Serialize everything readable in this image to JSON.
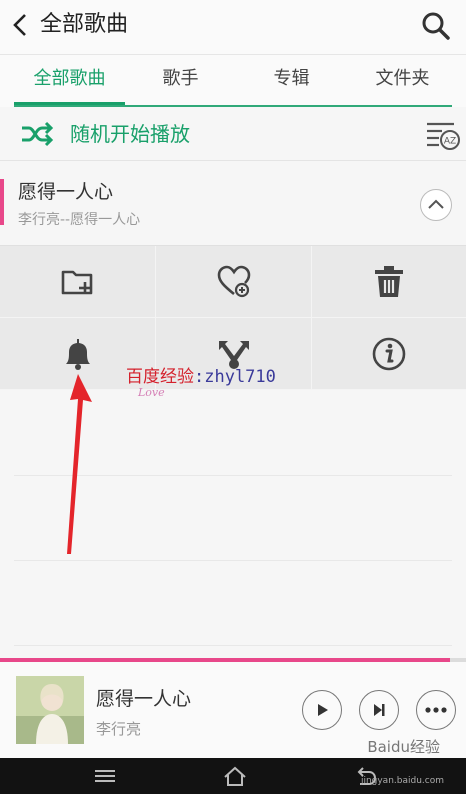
{
  "header": {
    "title": "全部歌曲"
  },
  "tabs": [
    {
      "label": "全部歌曲",
      "active": true
    },
    {
      "label": "歌手",
      "active": false
    },
    {
      "label": "专辑",
      "active": false
    },
    {
      "label": "文件夹",
      "active": false
    }
  ],
  "shuffle": {
    "label": "随机开始播放"
  },
  "song": {
    "title": "愿得一人心",
    "subtitle": "李行亮--愿得一人心"
  },
  "actions": [
    {
      "icon": "add-folder-icon"
    },
    {
      "icon": "favorite-heart-icon"
    },
    {
      "icon": "trash-icon"
    },
    {
      "icon": "bell-icon"
    },
    {
      "icon": "share-icon"
    },
    {
      "icon": "info-icon"
    }
  ],
  "watermark": {
    "red_text": "百度经验",
    "blue_text": ":zhyl710",
    "love": "Love"
  },
  "now_playing": {
    "title": "愿得一人心",
    "artist": "李行亮",
    "progress": 0.965
  },
  "brand": {
    "name": "Baidu经验",
    "url": "jingyan.baidu.com"
  },
  "colors": {
    "accent": "#19a06a",
    "pink": "#e8488a",
    "arrow": "#e4252b"
  }
}
